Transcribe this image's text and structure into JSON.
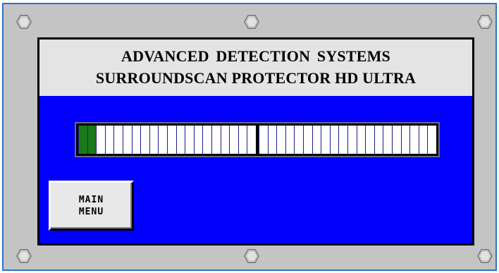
{
  "header": {
    "title_line1": "ADVANCED  DETECTION  SYSTEMS",
    "title_line2": "SURROUNDSCAN PROTECTOR HD ULTRA"
  },
  "bargraph": {
    "total_segments": 40,
    "lit_segments": 2,
    "lit_color": "#1a7a1a",
    "unlit_color": "#ffffff"
  },
  "controls": {
    "main_menu_label": "MAIN\nMENU"
  },
  "colors": {
    "screen_background": "#0000fc",
    "title_background": "#e4e4e4",
    "frame": "#c4c4c4",
    "frame_border": "#2c74c4"
  },
  "icons": {
    "corner_bolt": "hex-bolt-icon"
  }
}
